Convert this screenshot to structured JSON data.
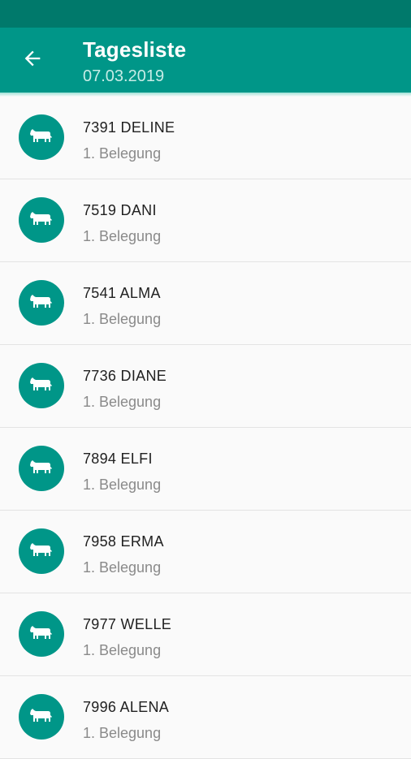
{
  "status_bar": {},
  "app_bar": {
    "back_icon": "arrow-left-icon",
    "title": "Tagesliste",
    "subtitle": "07.03.2019"
  },
  "list": {
    "icon": "cow-icon",
    "items": [
      {
        "name": "7391 DELINE",
        "detail": "1. Belegung"
      },
      {
        "name": "7519 DANI",
        "detail": "1. Belegung"
      },
      {
        "name": "7541 ALMA",
        "detail": "1. Belegung"
      },
      {
        "name": "7736 DIANE",
        "detail": "1. Belegung"
      },
      {
        "name": "7894 ELFI",
        "detail": "1. Belegung"
      },
      {
        "name": "7958 ERMA",
        "detail": "1. Belegung"
      },
      {
        "name": "7977 WELLE",
        "detail": "1. Belegung"
      },
      {
        "name": "7996 ALENA",
        "detail": "1. Belegung"
      }
    ]
  },
  "colors": {
    "primary": "#009688",
    "primary_dark": "#00796b",
    "background": "#fafafa"
  }
}
